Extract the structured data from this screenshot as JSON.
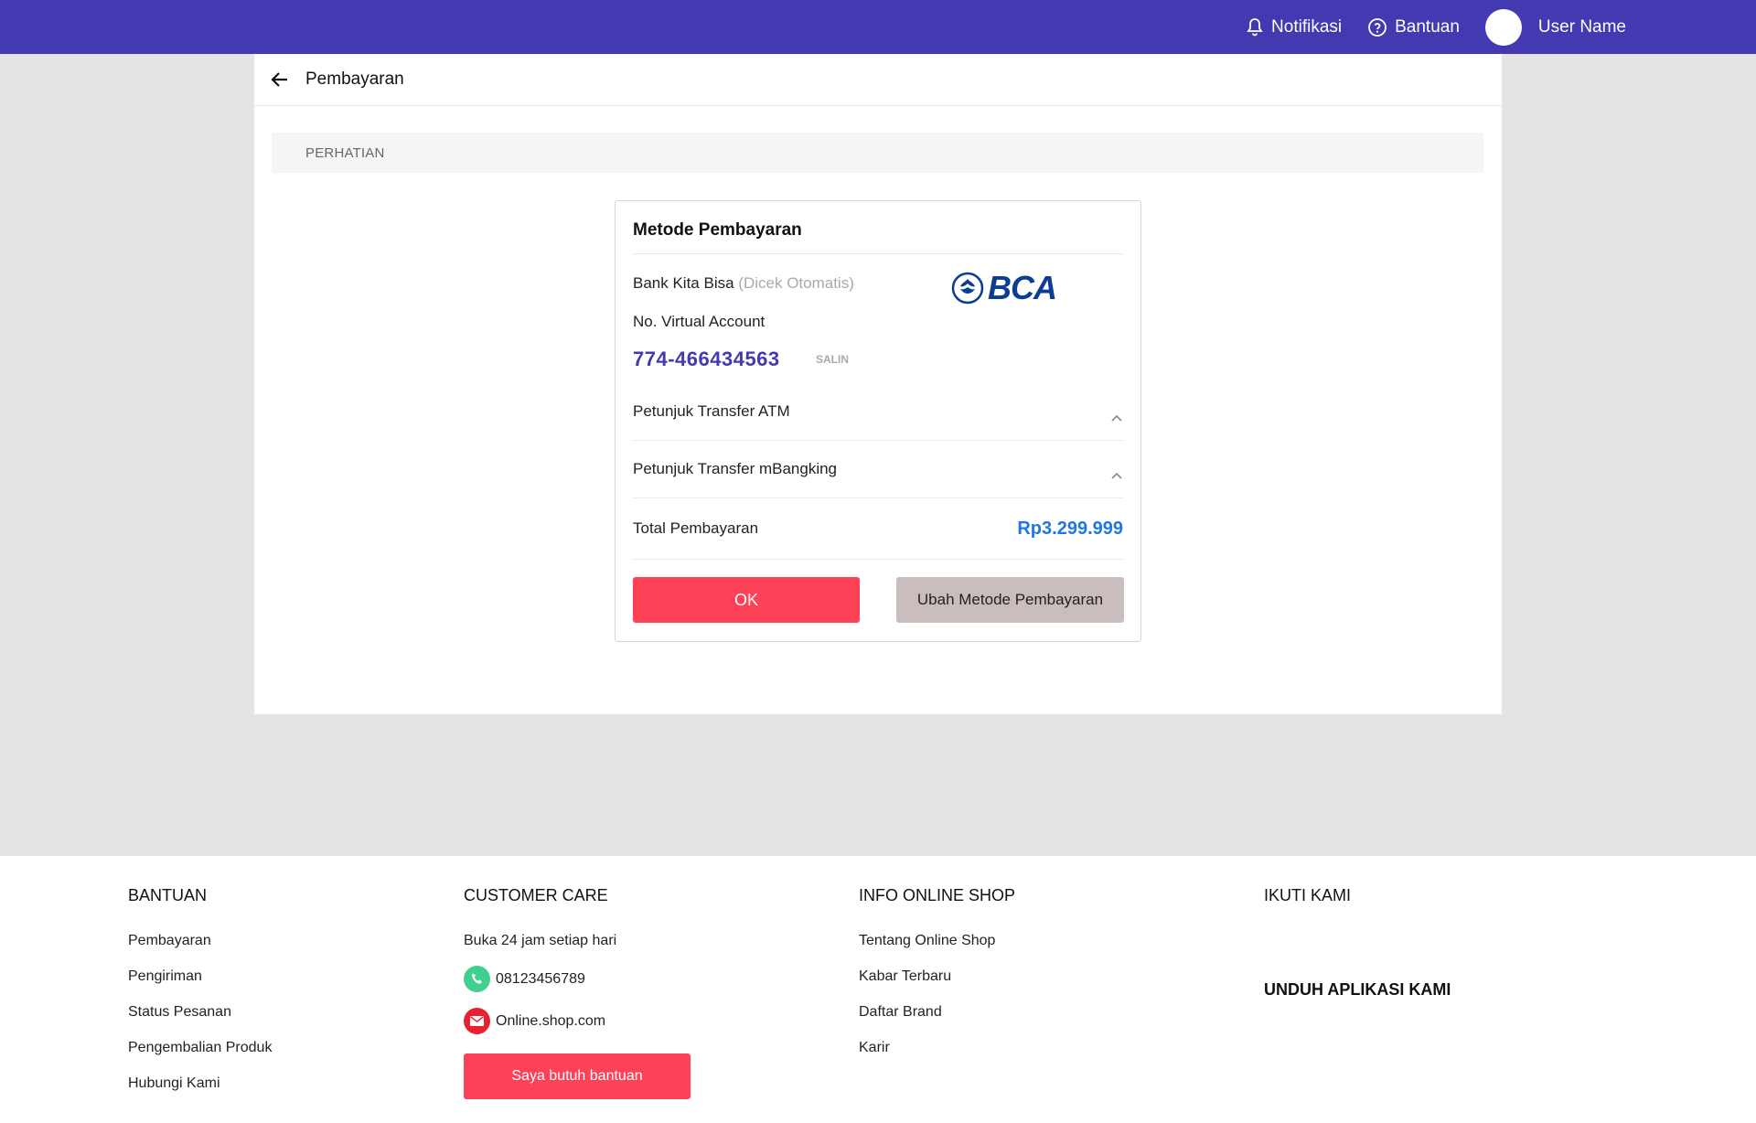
{
  "topbar": {
    "notifications_label": "Notifikasi",
    "help_label": "Bantuan",
    "user_name": "User Name"
  },
  "page": {
    "title": "Pembayaran",
    "notice": "PERHATIAN"
  },
  "payment": {
    "heading": "Metode Pembayaran",
    "bank_label": "Bank Kita Bisa",
    "bank_note": "(Dicek Otomatis)",
    "bank_logo_text": "BCA",
    "va_label": "No. Virtual Account",
    "va_number": "774-466434563",
    "copy_label": "SALIN",
    "atm_guide": "Petunjuk Transfer ATM",
    "mbanking_guide": "Petunjuk Transfer mBangking",
    "total_label": "Total Pembayaran",
    "total_amount": "Rp3.299.999",
    "ok_label": "OK",
    "change_label": "Ubah Metode Pembayaran"
  },
  "footer": {
    "help": {
      "title": "BANTUAN",
      "links": [
        "Pembayaran",
        "Pengiriman",
        "Status Pesanan",
        "Pengembalian Produk",
        "Hubungi Kami"
      ]
    },
    "care": {
      "title": "CUSTOMER CARE",
      "hours": "Buka 24 jam setiap hari",
      "phone": "08123456789",
      "email": "Online.shop.com",
      "help_button": "Saya butuh bantuan"
    },
    "info": {
      "title": "INFO ONLINE SHOP",
      "links": [
        "Tentang Online Shop",
        "Kabar Terbaru",
        "Daftar Brand",
        "Karir"
      ]
    },
    "follow": {
      "title": "IKUTI KAMI"
    },
    "download": {
      "title": "UNDUH APLIKASI KAMI"
    }
  },
  "colors": {
    "topbar": "#4339b1",
    "primary_button": "#fd4257",
    "secondary_button": "#c9bdbe",
    "va_number": "#4339b1",
    "total_amount": "#2177e0",
    "phone_icon": "#3fcf8e",
    "email_icon": "#e8202f"
  },
  "icons": [
    "bell-icon",
    "help-circle-icon",
    "avatar",
    "back-arrow-icon",
    "chevron-up-icon",
    "phone-icon",
    "mail-icon",
    "bca-logo"
  ]
}
